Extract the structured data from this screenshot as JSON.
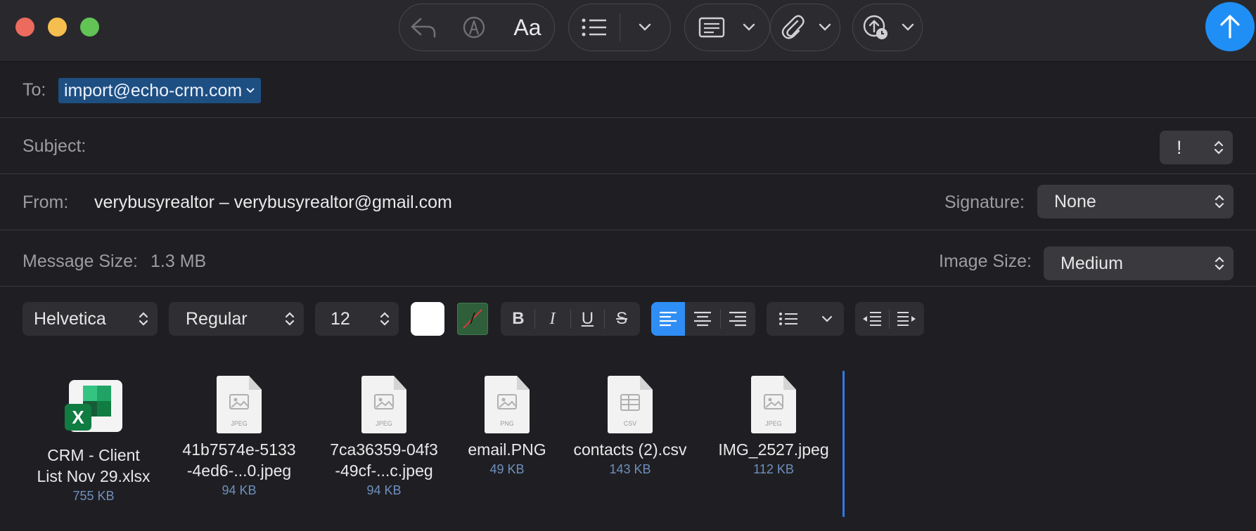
{
  "toolbar": {
    "font_toggle_label": "Aa"
  },
  "header": {
    "to_label": "To:",
    "to_recipient": "import@echo-crm.com",
    "subject_label": "Subject:",
    "subject_value": "",
    "priority_symbol": "!",
    "from_label": "From:",
    "from_value": "verybusyrealtor – verybusyrealtor@gmail.com",
    "signature_label": "Signature:",
    "signature_value": "None",
    "message_size_label": "Message Size:",
    "message_size_value": "1.3 MB",
    "image_size_label": "Image Size:",
    "image_size_value": "Medium"
  },
  "format_bar": {
    "font_family": "Helvetica",
    "font_style": "Regular",
    "font_size": "12",
    "bold": "B",
    "italic": "I",
    "underline": "U",
    "strike": "S"
  },
  "attachments": [
    {
      "name_line1": "CRM - Client",
      "name_line2": "List Nov 29.xlsx",
      "size": "755 KB",
      "kind": "excel-icon"
    },
    {
      "name_line1": "41b7574e-5133",
      "name_line2": "-4ed6-...0.jpeg",
      "size": "94 KB",
      "kind": "jpeg-file-icon",
      "ext": "JPEG"
    },
    {
      "name_line1": "7ca36359-04f3",
      "name_line2": "-49cf-...c.jpeg",
      "size": "94 KB",
      "kind": "jpeg-file-icon",
      "ext": "JPEG"
    },
    {
      "name_line1": "email.PNG",
      "name_line2": "",
      "size": "49 KB",
      "kind": "png-file-icon",
      "ext": "PNG"
    },
    {
      "name_line1": "contacts (2).csv",
      "name_line2": "",
      "size": "143 KB",
      "kind": "csv-file-icon",
      "ext": "CSV"
    },
    {
      "name_line1": "IMG_2527.jpeg",
      "name_line2": "",
      "size": "112 KB",
      "kind": "jpeg-file-icon",
      "ext": "JPEG"
    }
  ],
  "colors": {
    "accent": "#1f8ff5",
    "recipient_highlight": "#1e4f82",
    "background": "#1f1f23",
    "size_text": "#6f8fbd"
  }
}
